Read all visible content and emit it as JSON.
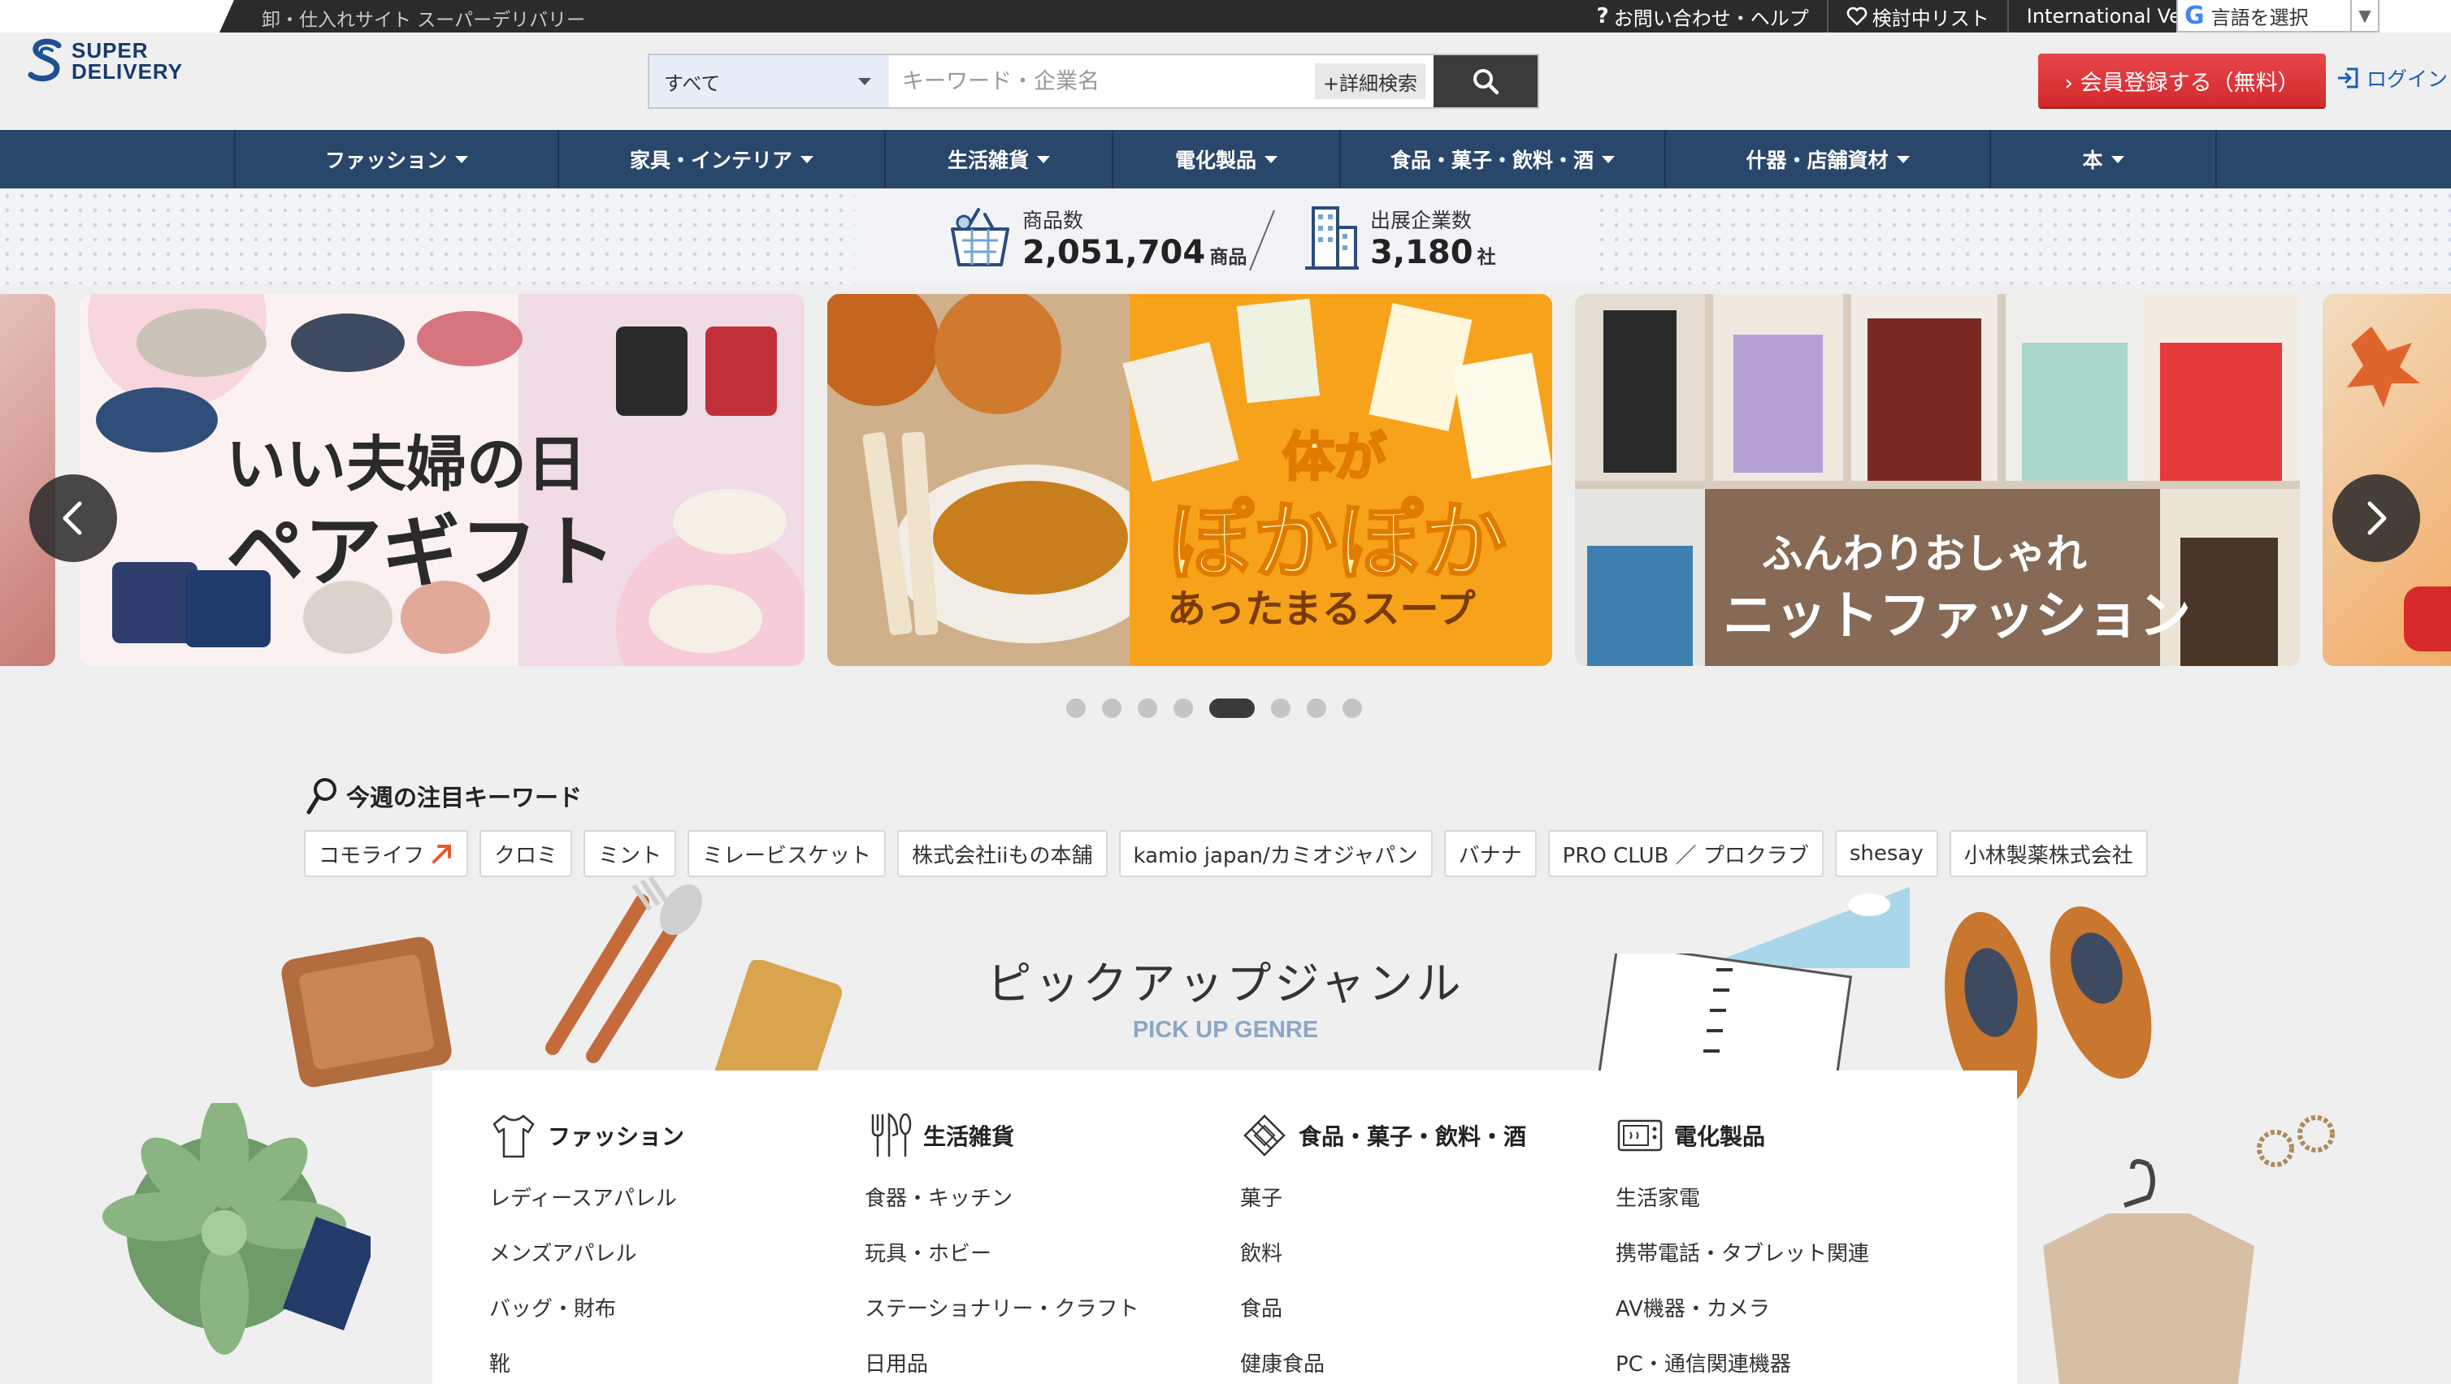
{
  "topbar": {
    "tagline": "卸・仕入れサイト スーパーデリバリー",
    "links": [
      {
        "icon": "question-icon",
        "label": "お問い合わせ・ヘルプ"
      },
      {
        "icon": "heart-icon",
        "label": "検討中リスト"
      },
      {
        "icon": "chevron-right-icon",
        "label": "International Ver."
      }
    ],
    "language": {
      "label": "言語を選択",
      "arrow": "▼",
      "logo": "G"
    }
  },
  "logo": {
    "line1": "SUPER",
    "line2": "DELIVERY"
  },
  "search": {
    "scope": "すべて",
    "placeholder": "キーワード・企業名",
    "advanced_label": "+詳細検索"
  },
  "header": {
    "register_label": "› 会員登録する（無料）",
    "login_label": "ログイン"
  },
  "nav": {
    "items": [
      "ファッション",
      "家具・インテリア",
      "生活雑貨",
      "電化製品",
      "食品・菓子・飲料・酒",
      "什器・店舗資材",
      "本"
    ]
  },
  "stats": {
    "products_label": "商品数",
    "products_value": "2,051,704",
    "products_unit": "商品",
    "companies_label": "出展企業数",
    "companies_value": "3,180",
    "companies_unit": "社"
  },
  "banners": [
    {
      "line1": "いい夫婦の日",
      "line2": "ペアギフト"
    },
    {
      "line1": "体が",
      "line2": "ぽかぽか",
      "line3": "あったまるスープ"
    },
    {
      "line1": "ふんわりおしゃれ",
      "line2": "ニットファッション"
    }
  ],
  "carousel": {
    "dot_count": 8,
    "active_index": 4
  },
  "keywords": {
    "title": "今週の注目キーワード",
    "items": [
      "コモライフ",
      "クロミ",
      "ミント",
      "ミレービスケット",
      "株式会社iiもの本舗",
      "kamio japan/カミオジャパン",
      "バナナ",
      "PRO CLUB ／ プロクラブ",
      "shesay",
      "小林製薬株式会社"
    ]
  },
  "pickup": {
    "title": "ピックアップジャンル",
    "subtitle": "PICK UP GENRE",
    "columns": [
      {
        "icon": "tshirt-icon",
        "title": "ファッション",
        "links": [
          "レディースアパレル",
          "メンズアパレル",
          "バッグ・財布",
          "靴"
        ]
      },
      {
        "icon": "cutlery-icon",
        "title": "生活雑貨",
        "links": [
          "食器・キッチン",
          "玩具・ホビー",
          "ステーショナリー・クラフト",
          "日用品"
        ]
      },
      {
        "icon": "food-icon",
        "title": "食品・菓子・飲料・酒",
        "links": [
          "菓子",
          "飲料",
          "食品",
          "健康食品"
        ]
      },
      {
        "icon": "microwave-icon",
        "title": "電化製品",
        "links": [
          "生活家電",
          "携帯電話・タブレット関連",
          "AV機器・カメラ",
          "PC・通信関連機器"
        ]
      }
    ]
  },
  "colors": {
    "nav_bg": "#29466b",
    "register_red": "#d2282d",
    "link_blue": "#1a5fb4",
    "accent_orange": "#f7a21b"
  }
}
